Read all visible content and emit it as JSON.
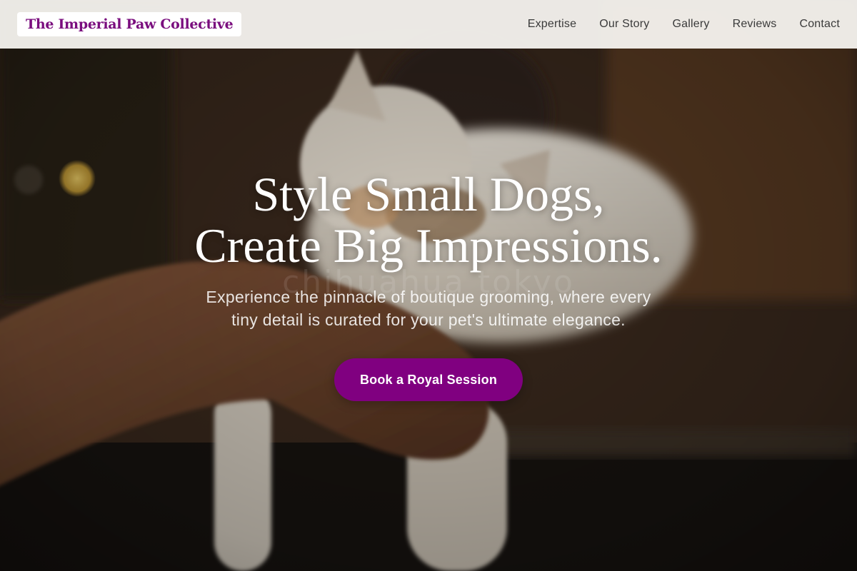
{
  "header": {
    "brand": "The Imperial Paw Collective",
    "nav": [
      {
        "label": "Expertise"
      },
      {
        "label": "Our Story"
      },
      {
        "label": "Gallery"
      },
      {
        "label": "Reviews"
      },
      {
        "label": "Contact"
      }
    ]
  },
  "hero": {
    "title_line1": "Style Small Dogs,",
    "title_line2": "Create Big Impressions.",
    "watermark": "chihuahua tokyo",
    "subtitle_line1": "Experience the pinnacle of boutique grooming, where every",
    "subtitle_line2": "tiny detail is curated for your pet's ultimate elegance.",
    "cta_label": "Book a Royal Session",
    "background_image": "cat-being-petted-photo"
  },
  "colors": {
    "brand": "#7a0d7e",
    "cta": "#800080",
    "header_bg": "#f8f5f1",
    "nav_text": "#3a3a3a"
  }
}
